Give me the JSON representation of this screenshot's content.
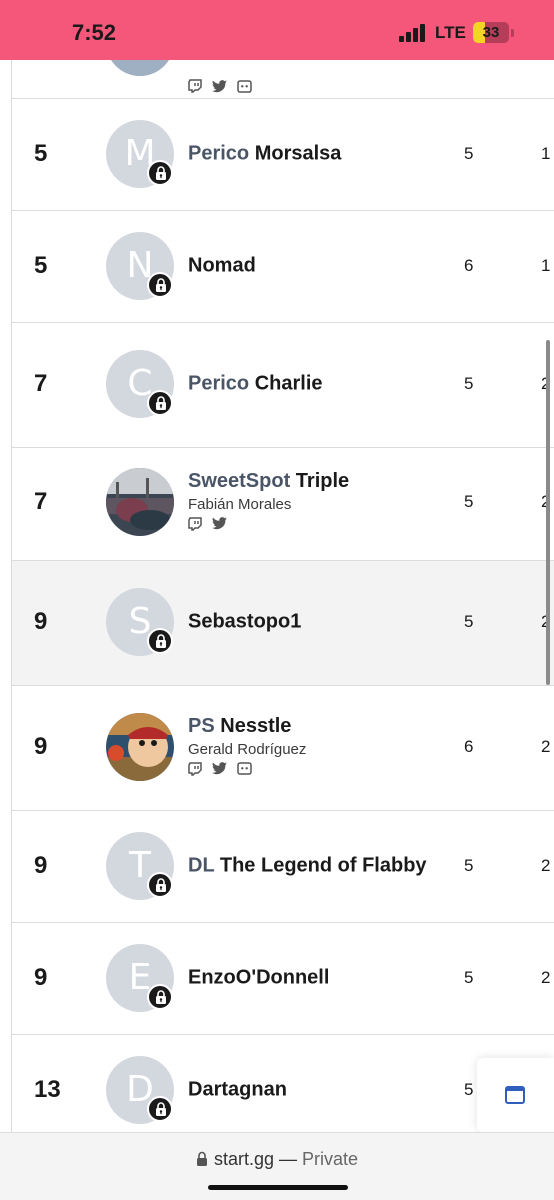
{
  "status_bar": {
    "time": "7:52",
    "network": "LTE",
    "battery": "33",
    "battery_fraction": 0.33
  },
  "browser": {
    "url": "start.gg",
    "separator": "—",
    "mode": "Private"
  },
  "rows": [
    {
      "placing": "5",
      "prefix": "Perico",
      "tag": "Morsalsa",
      "initial": "M",
      "seed": "5",
      "cut": "1"
    },
    {
      "placing": "5",
      "prefix": "",
      "tag": "Nomad",
      "initial": "N",
      "seed": "6",
      "cut": "1"
    },
    {
      "placing": "7",
      "prefix": "Perico",
      "tag": "Charlie",
      "initial": "C",
      "seed": "5",
      "cut": "2"
    },
    {
      "placing": "7",
      "prefix": "SweetSpot",
      "tag": "Triple",
      "real_name": "Fabián Morales",
      "seed": "5",
      "cut": "2",
      "socials": [
        "twitch-icon",
        "twitter-icon"
      ]
    },
    {
      "placing": "9",
      "prefix": "",
      "tag": "Sebastopo1",
      "initial": "S",
      "seed": "5",
      "cut": "2"
    },
    {
      "placing": "9",
      "prefix": "PS",
      "tag": "Nesstle",
      "real_name": "Gerald Rodríguez",
      "seed": "6",
      "cut": "2",
      "socials": [
        "twitch-icon",
        "twitter-icon",
        "discord-icon"
      ]
    },
    {
      "placing": "9",
      "prefix": "DL",
      "tag": "The Legend of Flabby",
      "initial": "T",
      "seed": "5",
      "cut": "2"
    },
    {
      "placing": "9",
      "prefix": "",
      "tag": "EnzoO'Donnell",
      "initial": "E",
      "seed": "5",
      "cut": "2"
    },
    {
      "placing": "13",
      "prefix": "",
      "tag": "Dartagnan",
      "initial": "D",
      "seed": "5",
      "cut": ""
    }
  ],
  "colors": {
    "status_bar": "#f4577a",
    "avatar_placeholder": "#d3d7de",
    "accent": "#2e5fbe",
    "row_highlight": "#f3f3f3"
  }
}
